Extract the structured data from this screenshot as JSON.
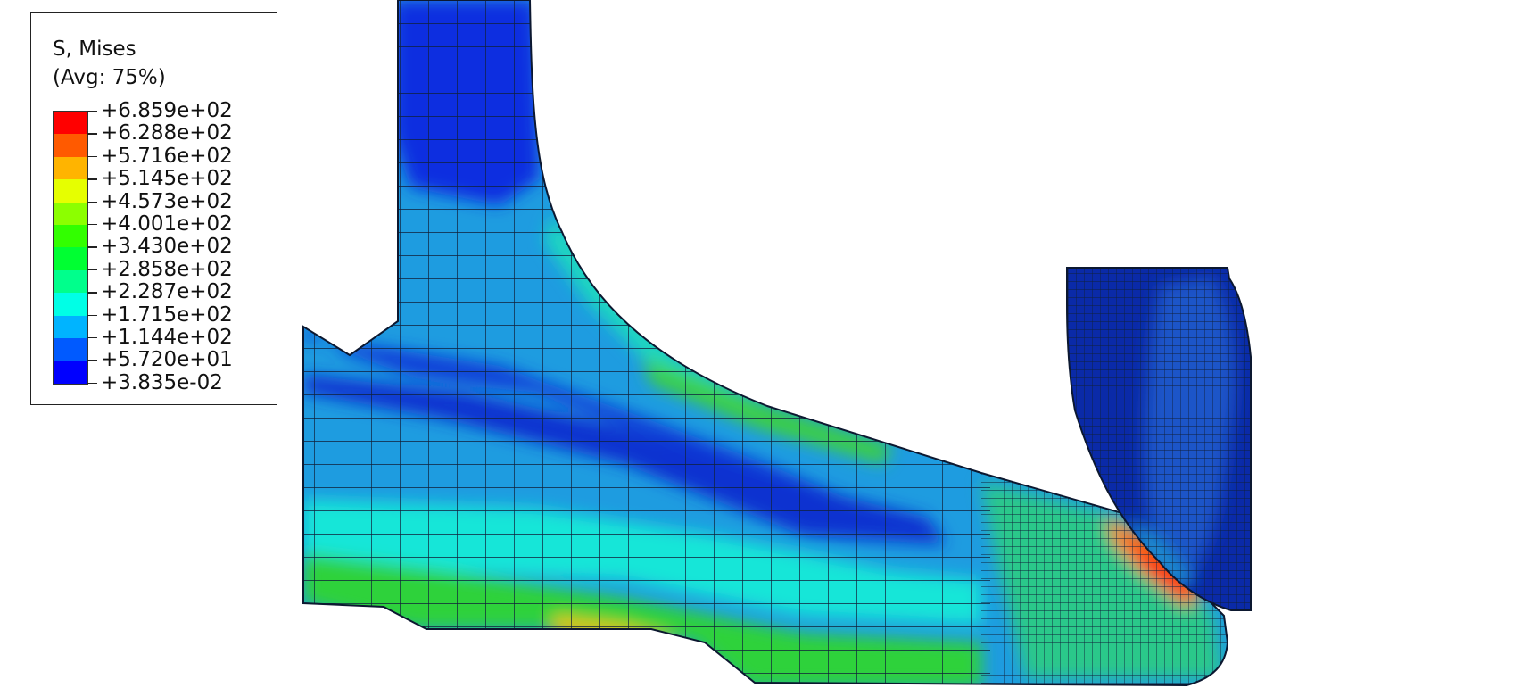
{
  "legend": {
    "title": "S, Mises",
    "subtitle": "(Avg: 75%)",
    "ticks": [
      "+6.859e+02",
      "+6.288e+02",
      "+5.716e+02",
      "+5.145e+02",
      "+4.573e+02",
      "+4.001e+02",
      "+3.430e+02",
      "+2.858e+02",
      "+2.287e+02",
      "+1.715e+02",
      "+1.144e+02",
      "+5.720e+01",
      "+3.835e-02"
    ],
    "colors": [
      "#ff0000",
      "#ff5a00",
      "#ffb400",
      "#e6ff00",
      "#8cff00",
      "#32ff00",
      "#00ff32",
      "#00ff8c",
      "#00ffe6",
      "#00b4ff",
      "#005aff",
      "#0000ff"
    ]
  },
  "model": {
    "body_fill": "#1f9ae0",
    "tool_fill": "#0a2aa8",
    "mesh_color": "#102040"
  }
}
